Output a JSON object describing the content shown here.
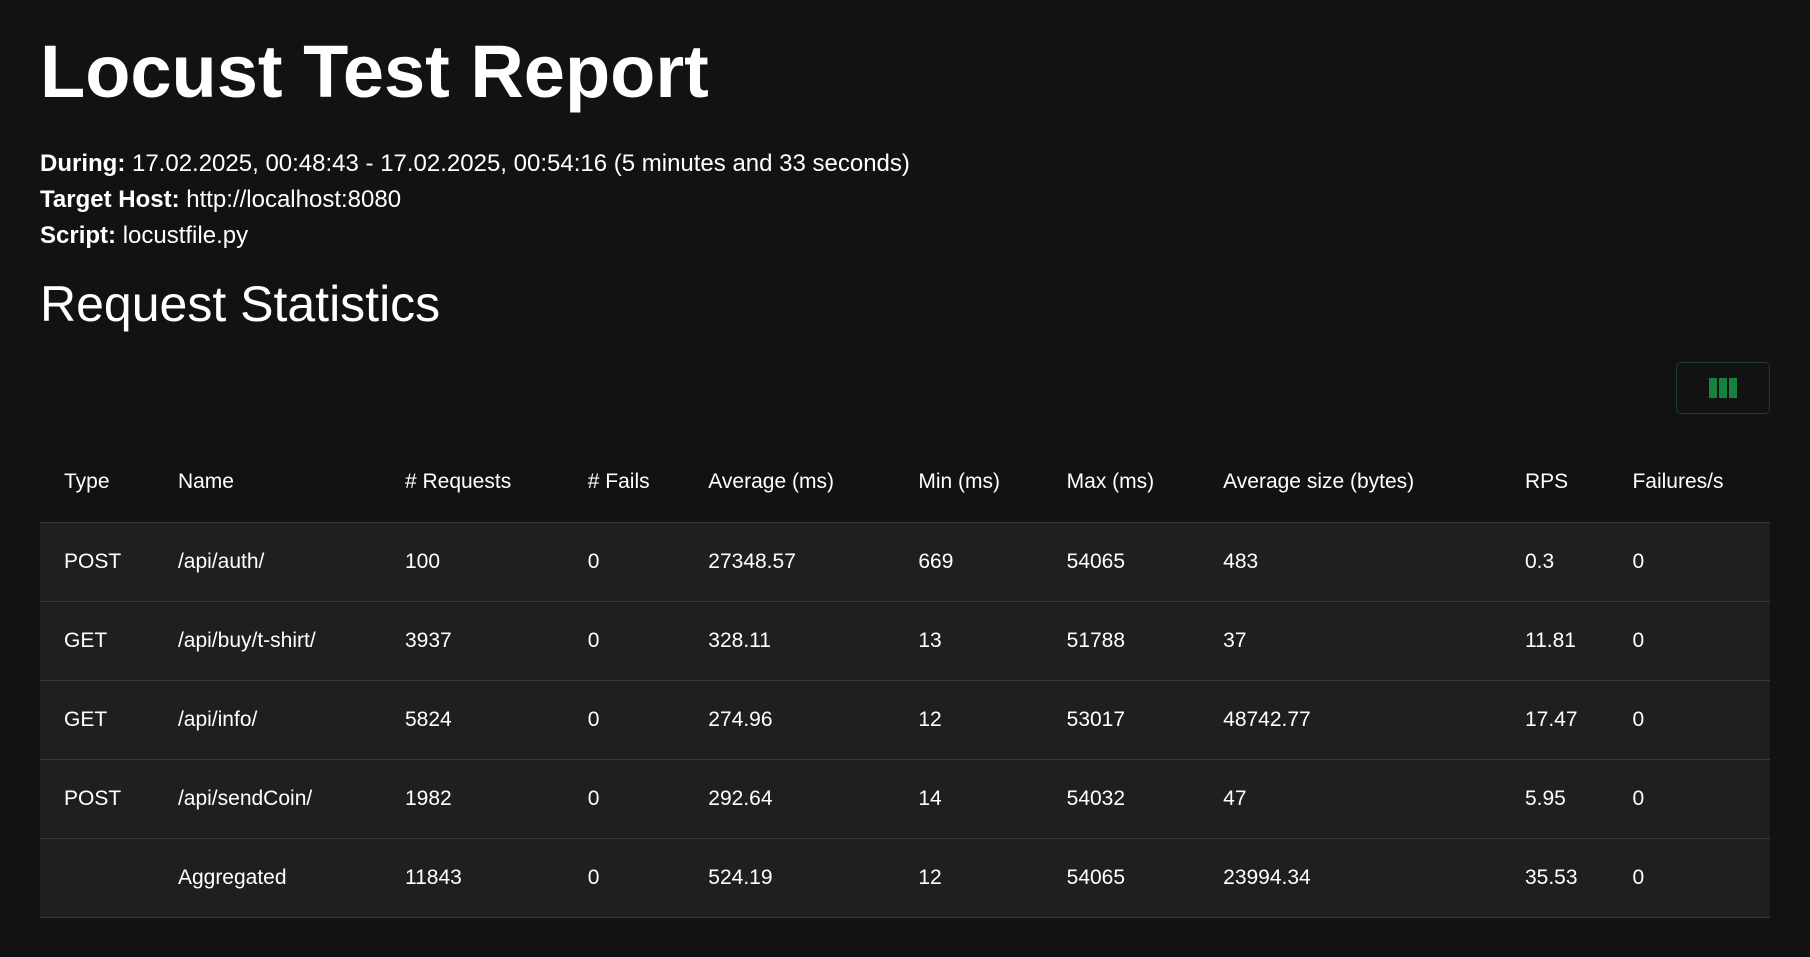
{
  "report": {
    "title": "Locust Test Report",
    "during_label": "During:",
    "during_value": "17.02.2025, 00:48:43 - 17.02.2025, 00:54:16 (5 minutes and 33 seconds)",
    "host_label": "Target Host:",
    "host_value": "http://localhost:8080",
    "script_label": "Script:",
    "script_value": "locustfile.py"
  },
  "section": {
    "title": "Request Statistics"
  },
  "toolbar": {
    "columns_icon": "columns-icon",
    "accent_color": "#15833c"
  },
  "table": {
    "headers": [
      "Type",
      "Name",
      "# Requests",
      "# Fails",
      "Average (ms)",
      "Min (ms)",
      "Max (ms)",
      "Average size (bytes)",
      "RPS",
      "Failures/s"
    ],
    "rows": [
      [
        "POST",
        "/api/auth/",
        "100",
        "0",
        "27348.57",
        "669",
        "54065",
        "483",
        "0.3",
        "0"
      ],
      [
        "GET",
        "/api/buy/t-shirt/",
        "3937",
        "0",
        "328.11",
        "13",
        "51788",
        "37",
        "11.81",
        "0"
      ],
      [
        "GET",
        "/api/info/",
        "5824",
        "0",
        "274.96",
        "12",
        "53017",
        "48742.77",
        "17.47",
        "0"
      ],
      [
        "POST",
        "/api/sendCoin/",
        "1982",
        "0",
        "292.64",
        "14",
        "54032",
        "47",
        "5.95",
        "0"
      ],
      [
        "",
        "Aggregated",
        "11843",
        "0",
        "524.19",
        "12",
        "54065",
        "23994.34",
        "35.53",
        "0"
      ]
    ]
  }
}
